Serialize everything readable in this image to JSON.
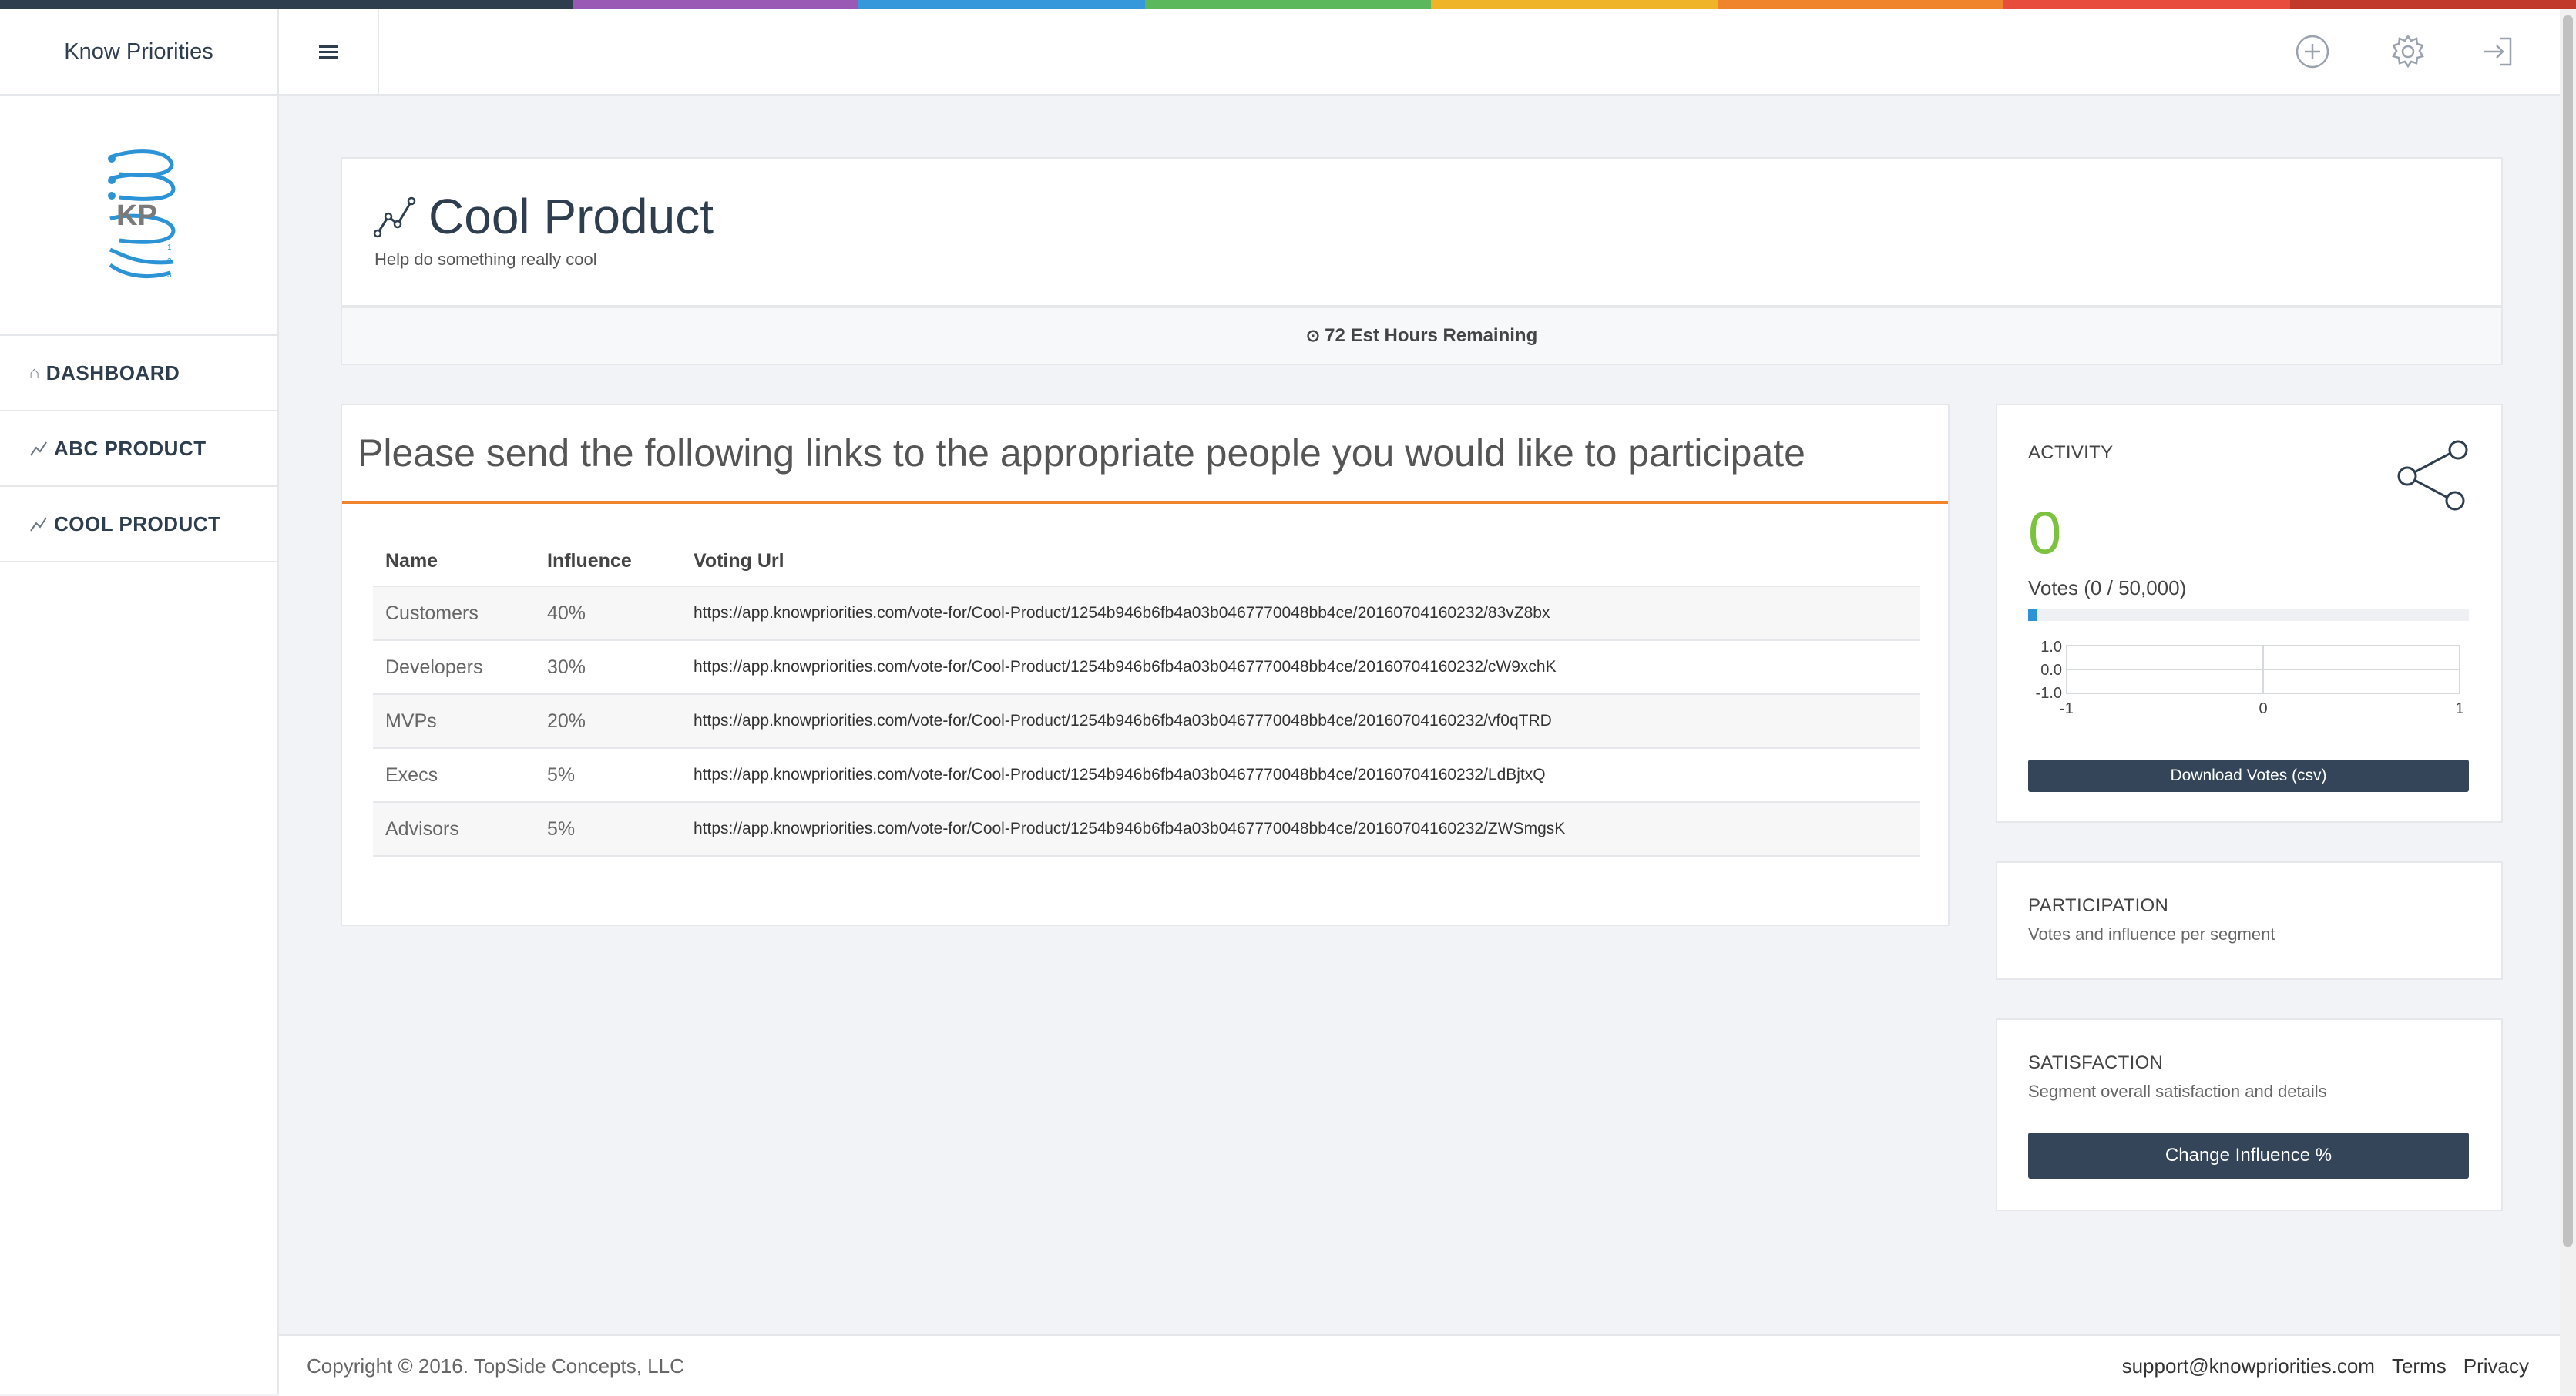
{
  "colors": {
    "stripe": [
      "#2f3e4e",
      "#2f3e4e",
      "#9b59b6",
      "#3498db",
      "#5cb85c",
      "#f0b429",
      "#f0842c",
      "#e74c3c",
      "#c0392b"
    ],
    "accent_orange": "#f0842c",
    "activity_green": "#7dc23f",
    "button_dark": "#34455a"
  },
  "sidebar": {
    "brand": "Know Priorities",
    "logo_text": "KP",
    "items": [
      {
        "label": "DASHBOARD",
        "icon": "home-icon"
      },
      {
        "label": "ABC PRODUCT",
        "icon": "chart-line-icon"
      },
      {
        "label": "COOL PRODUCT",
        "icon": "chart-line-icon"
      }
    ]
  },
  "header": {
    "icons": [
      "plus-circle-icon",
      "gear-icon",
      "logout-icon"
    ]
  },
  "product": {
    "title": "Cool Product",
    "subtitle": "Help do something really cool",
    "hours_remaining": "72 Est Hours Remaining"
  },
  "links": {
    "heading": "Please send the following links to the appropriate people you would like to participate",
    "columns": [
      "Name",
      "Influence",
      "Voting Url"
    ],
    "rows": [
      {
        "name": "Customers",
        "influence": "40%",
        "url": "https://app.knowpriorities.com/vote-for/Cool-Product/1254b946b6fb4a03b0467770048bb4ce/20160704160232/83vZ8bx"
      },
      {
        "name": "Developers",
        "influence": "30%",
        "url": "https://app.knowpriorities.com/vote-for/Cool-Product/1254b946b6fb4a03b0467770048bb4ce/20160704160232/cW9xchK"
      },
      {
        "name": "MVPs",
        "influence": "20%",
        "url": "https://app.knowpriorities.com/vote-for/Cool-Product/1254b946b6fb4a03b0467770048bb4ce/20160704160232/vf0qTRD"
      },
      {
        "name": "Execs",
        "influence": "5%",
        "url": "https://app.knowpriorities.com/vote-for/Cool-Product/1254b946b6fb4a03b0467770048bb4ce/20160704160232/LdBjtxQ"
      },
      {
        "name": "Advisors",
        "influence": "5%",
        "url": "https://app.knowpriorities.com/vote-for/Cool-Product/1254b946b6fb4a03b0467770048bb4ce/20160704160232/ZWSmgsK"
      }
    ]
  },
  "activity": {
    "title": "ACTIVITY",
    "count": "0",
    "votes_label": "Votes (0 / 50,000)",
    "progress_fraction": 0.02,
    "mini_chart": {
      "y_ticks": [
        "1.0",
        "0.0",
        "-1.0"
      ],
      "x_ticks": [
        "-1",
        "0",
        "1"
      ]
    },
    "download_label": "Download Votes (csv)"
  },
  "participation": {
    "title": "PARTICIPATION",
    "subtitle": "Votes and influence per segment"
  },
  "satisfaction": {
    "title": "SATISFACTION",
    "subtitle": "Segment overall satisfaction and details",
    "button_label": "Change Influence %"
  },
  "footer": {
    "copyright": "Copyright © 2016. TopSide Concepts, LLC",
    "support_email": "support@knowpriorities.com",
    "terms": "Terms",
    "privacy": "Privacy"
  }
}
